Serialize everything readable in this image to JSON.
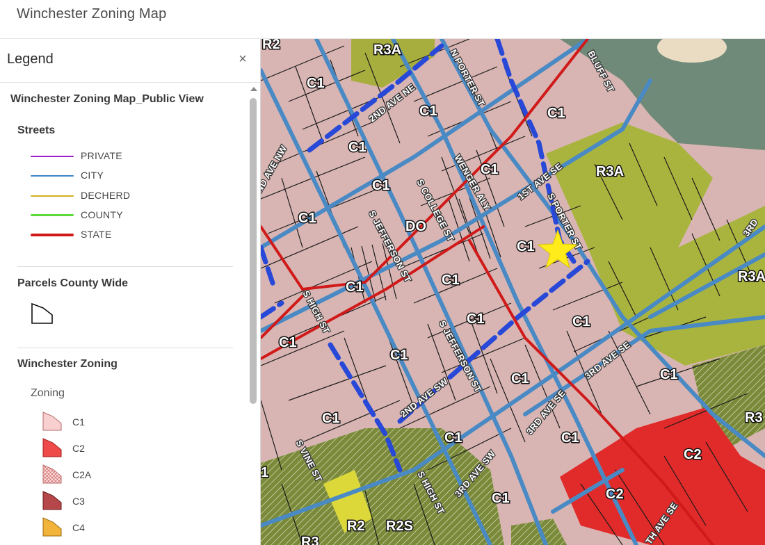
{
  "app": {
    "title": "Winchester Zoning Map"
  },
  "legend": {
    "title": "Legend",
    "close_symbol": "×",
    "layer_title": "Winchester Zoning Map_Public View",
    "streets": {
      "title": "Streets",
      "items": [
        {
          "label": "PRIVATE",
          "color": "#a020c8"
        },
        {
          "label": "CITY",
          "color": "#3a86c8"
        },
        {
          "label": "DECHERD",
          "color": "#d4b020"
        },
        {
          "label": "COUNTY",
          "color": "#5cd83a"
        },
        {
          "label": "STATE",
          "color": "#d01a1a"
        }
      ]
    },
    "parcels": {
      "title": "Parcels County Wide"
    },
    "zoning": {
      "title": "Winchester Zoning",
      "subtitle": "Zoning",
      "items": [
        {
          "label": "C1",
          "color": "#f9d0d0"
        },
        {
          "label": "C2",
          "color": "#ef4a4a"
        },
        {
          "label": "C2A",
          "color": "#f4b8b8"
        },
        {
          "label": "C3",
          "color": "#b5474a"
        },
        {
          "label": "C4",
          "color": "#f2b33a"
        }
      ]
    }
  },
  "map": {
    "marker_icon": "star-icon",
    "zone_labels": [
      {
        "text": "R2"
      },
      {
        "text": "R3A"
      },
      {
        "text": "C1"
      },
      {
        "text": "C1"
      },
      {
        "text": "C1"
      },
      {
        "text": "C1"
      },
      {
        "text": "C1"
      },
      {
        "text": "R3A"
      },
      {
        "text": "C1"
      },
      {
        "text": "C1"
      },
      {
        "text": "DO"
      },
      {
        "text": "C1"
      },
      {
        "text": "C1"
      },
      {
        "text": "C1"
      },
      {
        "text": "R3A"
      },
      {
        "text": "C1"
      },
      {
        "text": "C1"
      },
      {
        "text": "C1"
      },
      {
        "text": "C1"
      },
      {
        "text": "C1"
      },
      {
        "text": "C1"
      },
      {
        "text": "C1"
      },
      {
        "text": "C1"
      },
      {
        "text": "R3"
      },
      {
        "text": "C2"
      },
      {
        "text": "C2"
      },
      {
        "text": "C1"
      },
      {
        "text": "R2"
      },
      {
        "text": "R2S"
      },
      {
        "text": "R3"
      },
      {
        "text": "1"
      }
    ],
    "street_labels": [
      {
        "text": "2ND AVE NE"
      },
      {
        "text": "N PORTER ST"
      },
      {
        "text": "BLUFF ST"
      },
      {
        "text": "ND AVE NW"
      },
      {
        "text": "WENGER ALY"
      },
      {
        "text": "1ST AVE SE"
      },
      {
        "text": "S COLLEGE ST"
      },
      {
        "text": "S PORTER ST"
      },
      {
        "text": "S JEFFERSON ST"
      },
      {
        "text": "S HIGH ST"
      },
      {
        "text": "S JEFFERSON ST"
      },
      {
        "text": "3RD AVE SE"
      },
      {
        "text": "2ND AVE SW"
      },
      {
        "text": "3RD AVE SE"
      },
      {
        "text": "S VINE ST"
      },
      {
        "text": "S HIGH ST"
      },
      {
        "text": "3RD AVE SW"
      },
      {
        "text": "TH AVE SE"
      },
      {
        "text": "3RD"
      }
    ]
  }
}
